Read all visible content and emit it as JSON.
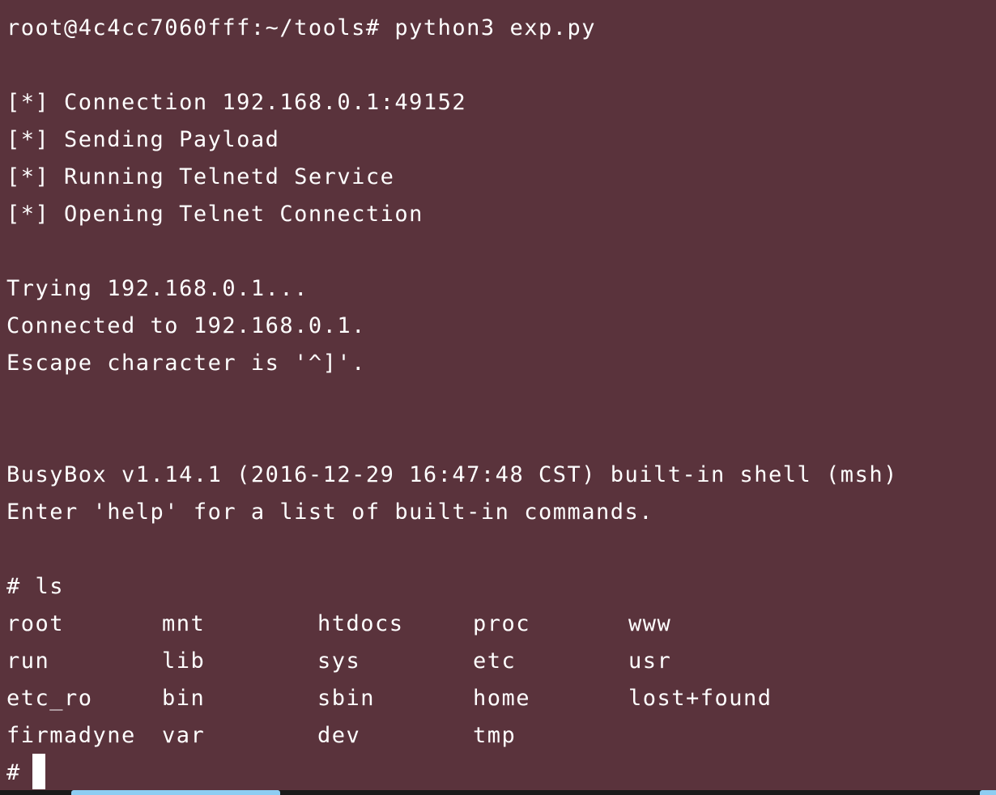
{
  "terminal": {
    "lines": [
      "root@4c4cc7060fff:~/tools# python3 exp.py",
      "",
      "[*] Connection 192.168.0.1:49152",
      "[*] Sending Payload",
      "[*] Running Telnetd Service",
      "[*] Opening Telnet Connection",
      "",
      "Trying 192.168.0.1...",
      "Connected to 192.168.0.1.",
      "Escape character is '^]'.",
      "",
      "",
      "BusyBox v1.14.1 (2016-12-29 16:47:48 CST) built-in shell (msh)",
      "Enter 'help' for a list of built-in commands.",
      "",
      "# ls"
    ],
    "ls_rows": [
      [
        "root",
        "mnt",
        "htdocs",
        "proc",
        "www"
      ],
      [
        "run",
        "lib",
        "sys",
        "etc",
        "usr"
      ],
      [
        "etc_ro",
        "bin",
        "sbin",
        "home",
        "lost+found"
      ],
      [
        "firmadyne",
        "var",
        "dev",
        "tmp",
        ""
      ]
    ],
    "prompt": "#"
  },
  "colors": {
    "background": "#5a333c",
    "foreground": "#ffffff",
    "scroll_thumb": "#8ecdf2"
  }
}
